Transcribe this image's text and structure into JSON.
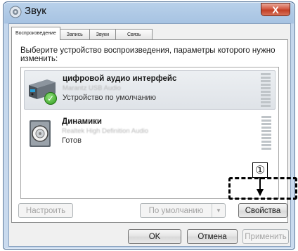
{
  "window": {
    "title": "Звук",
    "close_label": "X"
  },
  "tabs": [
    {
      "label": "Воспроизведение",
      "active": true
    },
    {
      "label": "Запись",
      "active": false
    },
    {
      "label": "Звуки",
      "active": false
    },
    {
      "label": "Связь",
      "active": false
    }
  ],
  "prompt": "Выберите устройство воспроизведения, параметры которого нужно изменить:",
  "devices": [
    {
      "name": "цифровой аудио интерфейс",
      "subtitle": "Marantz USB Audio",
      "status": "Устройство по умолчанию",
      "selected": true,
      "icon": "digital-audio-interface-icon"
    },
    {
      "name": "Динамики",
      "subtitle": "Realtek High Definition Audio",
      "status": "Готов",
      "selected": false,
      "icon": "speaker-icon"
    }
  ],
  "buttons": {
    "configure": "Настроить",
    "set_default": "По умолчанию",
    "properties": "Свойства",
    "ok": "OK",
    "cancel": "Отмена",
    "apply": "Применить"
  },
  "callout": {
    "number": "①"
  },
  "colors": {
    "accent_check": "#2e9a1c",
    "close_button": "#c23f25"
  }
}
